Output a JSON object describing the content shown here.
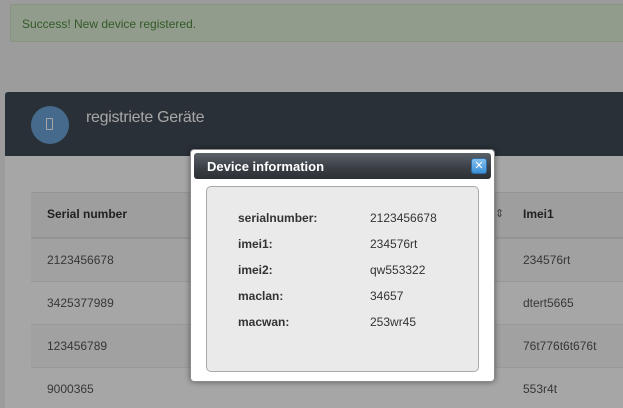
{
  "alert": {
    "text": "Success! New device registered."
  },
  "panel": {
    "title": "registriete Geräte"
  },
  "table": {
    "columns": [
      "Serial number",
      "Imei1"
    ],
    "rows": [
      {
        "serial": "2123456678",
        "imei1": "234576rt"
      },
      {
        "serial": "3425377989",
        "imei1": "dtert5665"
      },
      {
        "serial": "123456789",
        "imei1": "76t776t6t676t"
      },
      {
        "serial": "9000365",
        "imei1": "553r4t"
      }
    ]
  },
  "dialog": {
    "title": "Device information",
    "close_icon": "close-x-icon",
    "fields": [
      {
        "label": "serialnumber:",
        "value": "2123456678"
      },
      {
        "label": "imei1:",
        "value": "234576rt"
      },
      {
        "label": "imei2:",
        "value": "qw553322"
      },
      {
        "label": "maclan:",
        "value": "34657"
      },
      {
        "label": "macwan:",
        "value": "253wr45"
      }
    ]
  },
  "colors": {
    "alert_bg": "#dff0d8",
    "panel_header": "#3f4b56",
    "accent_blue": "#3a8fd8",
    "dialog_titlebar": "#3b4046"
  }
}
